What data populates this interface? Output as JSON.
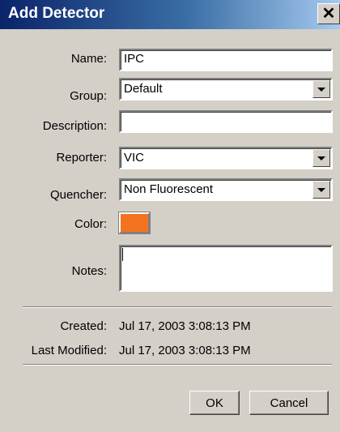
{
  "window": {
    "title": "Add Detector",
    "close_glyph": "✕"
  },
  "form": {
    "name": {
      "label": "Name:",
      "value": "IPC"
    },
    "group": {
      "label": "Group:",
      "value": "Default"
    },
    "description": {
      "label": "Description:",
      "value": ""
    },
    "reporter": {
      "label": "Reporter:",
      "value": "VIC"
    },
    "quencher": {
      "label": "Quencher:",
      "value": "Non Fluorescent"
    },
    "color": {
      "label": "Color:",
      "value": "#f4731f"
    },
    "notes": {
      "label": "Notes:",
      "value": ""
    }
  },
  "info": {
    "created": {
      "label": "Created:",
      "value": "Jul 17, 2003 3:08:13 PM"
    },
    "last_modified": {
      "label": "Last Modified:",
      "value": "Jul 17, 2003 3:08:13 PM"
    }
  },
  "buttons": {
    "ok": "OK",
    "cancel": "Cancel"
  },
  "icons": {
    "close": "close-icon",
    "dropdown": "chevron-down-icon"
  }
}
